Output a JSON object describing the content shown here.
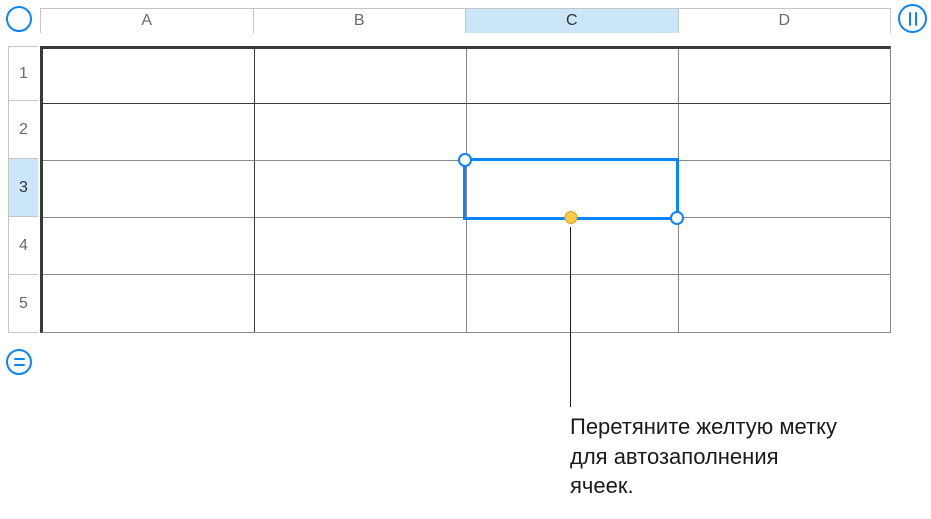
{
  "columns": [
    "A",
    "B",
    "C",
    "D"
  ],
  "rows": [
    "1",
    "2",
    "3",
    "4",
    "5"
  ],
  "selected_column": "C",
  "selected_row": "3",
  "callout": "Перетяните желтую метку для автозаполнения ячеек.",
  "icons": {
    "corner": "circle-icon",
    "bars": "columns-icon",
    "equals": "equals-icon"
  }
}
